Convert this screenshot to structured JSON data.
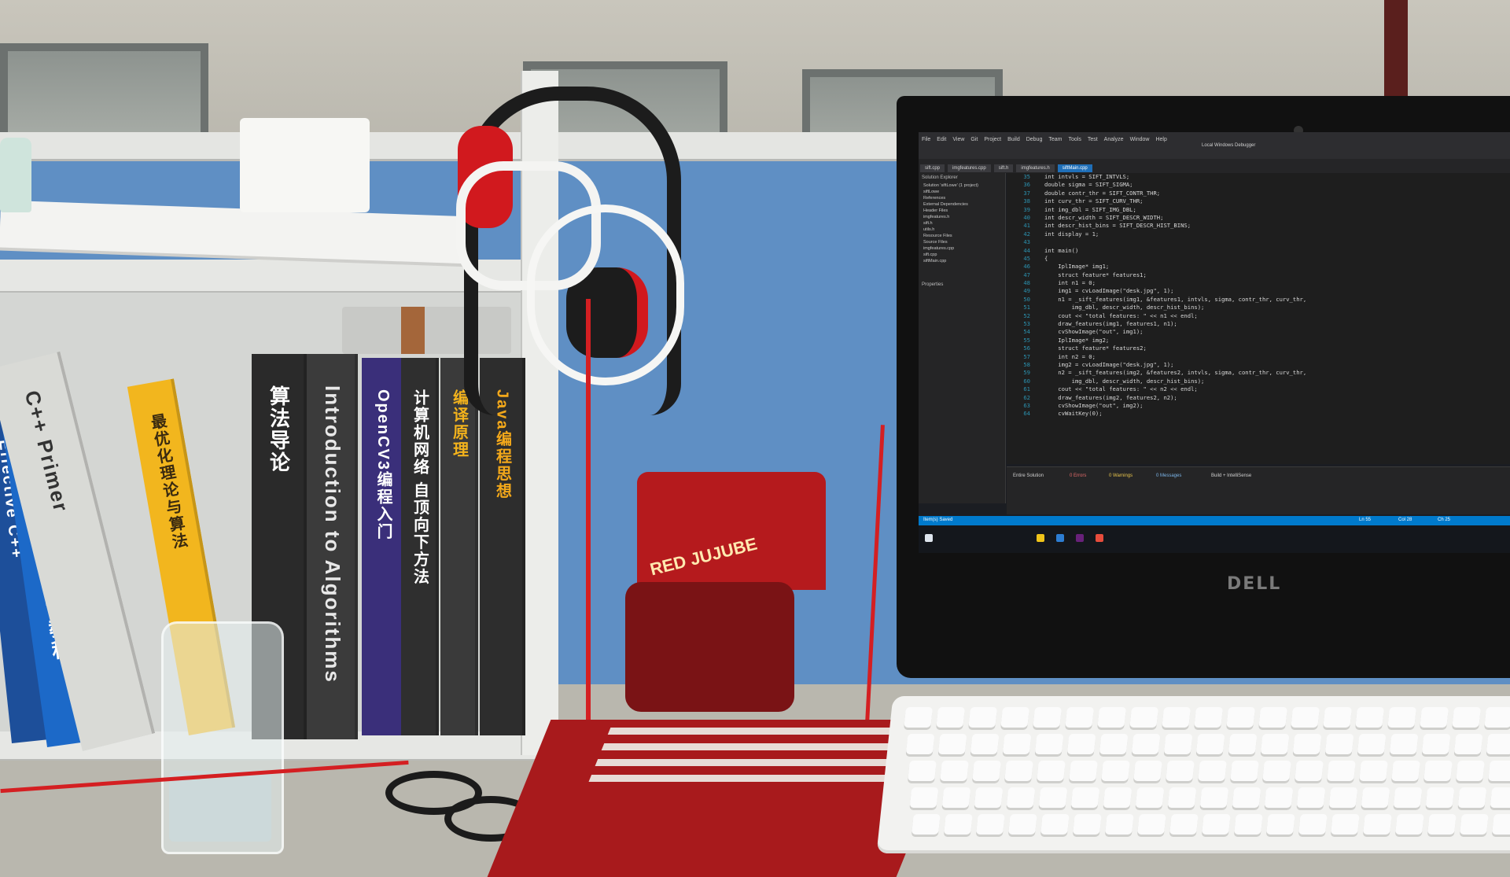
{
  "scene": {
    "description_tags": [
      "desk",
      "bookshelf",
      "monitor",
      "keyboard",
      "headphones",
      "jujube-bag",
      "glass-jar"
    ]
  },
  "books": [
    {
      "title": "Effective C++",
      "color": "#1d4f9a",
      "text_color": "#ffffff"
    },
    {
      "title": "Verilog 数字系统设计教程",
      "color": "#1c69c8",
      "text_color": "#ffffff"
    },
    {
      "title": "C++ Primer",
      "color": "#d9dad6",
      "text_color": "#333333"
    },
    {
      "title": "最优化理论与算法",
      "color": "#f2b61e",
      "text_color": "#3a2a10"
    },
    {
      "title": "算法导论",
      "color": "#2a2a2a",
      "text_color": "#ffffff"
    },
    {
      "title": "Introduction to Algorithms",
      "color": "#3b3b3b",
      "text_color": "#e8e8e8"
    },
    {
      "title": "OpenCV3编程入门",
      "color": "#3a2f7a",
      "text_color": "#ffffff"
    },
    {
      "title": "计算机网络 自顶向下方法",
      "color": "#2f2f2f",
      "text_color": "#ffffff"
    },
    {
      "title": "编译原理",
      "color": "#3a3a3a",
      "text_color": "#f2b21c"
    },
    {
      "title": "Java编程思想",
      "color": "#2d2d2d",
      "text_color": "#f3a81a"
    }
  ],
  "monitor": {
    "brand": "DELL",
    "ide": {
      "menu": [
        "File",
        "Edit",
        "View",
        "Git",
        "Project",
        "Build",
        "Debug",
        "Team",
        "Tools",
        "Test",
        "Analyze",
        "Window",
        "Help"
      ],
      "debugger_label": "Local Windows Debugger",
      "tabs": [
        "sift.cpp",
        "imgfeatures.cpp",
        "sift.h",
        "imgfeatures.h",
        "siftMain.cpp"
      ],
      "active_tab": "siftMain.cpp",
      "solution_title": "Solution Explorer",
      "solution_items": [
        "Solution 'siftLowe' (1 project)",
        "siftLowe",
        "References",
        "External Dependencies",
        "Header Files",
        "imgfeatures.h",
        "sift.h",
        "utils.h",
        "Resource Files",
        "Source Files",
        "imgfeatures.cpp",
        "sift.cpp",
        "siftMain.cpp"
      ],
      "properties_title": "Properties",
      "code_lines": [
        {
          "n": "35",
          "text": "int intvls = SIFT_INTVLS;"
        },
        {
          "n": "36",
          "text": "double sigma = SIFT_SIGMA;"
        },
        {
          "n": "37",
          "text": "double contr_thr = SIFT_CONTR_THR;"
        },
        {
          "n": "38",
          "text": "int curv_thr = SIFT_CURV_THR;"
        },
        {
          "n": "39",
          "text": "int img_dbl = SIFT_IMG_DBL;"
        },
        {
          "n": "40",
          "text": "int descr_width = SIFT_DESCR_WIDTH;"
        },
        {
          "n": "41",
          "text": "int descr_hist_bins = SIFT_DESCR_HIST_BINS;"
        },
        {
          "n": "42",
          "text": "int display = 1;"
        },
        {
          "n": "43",
          "text": ""
        },
        {
          "n": "44",
          "text": "int main()"
        },
        {
          "n": "45",
          "text": "{"
        },
        {
          "n": "46",
          "text": "    IplImage* img1;"
        },
        {
          "n": "47",
          "text": "    struct feature* features1;"
        },
        {
          "n": "48",
          "text": "    int n1 = 0;"
        },
        {
          "n": "49",
          "text": "    img1 = cvLoadImage(\"desk.jpg\", 1);"
        },
        {
          "n": "50",
          "text": "    n1 = _sift_features(img1, &features1, intvls, sigma, contr_thr, curv_thr,"
        },
        {
          "n": "51",
          "text": "        img_dbl, descr_width, descr_hist_bins);"
        },
        {
          "n": "52",
          "text": "    cout << \"total features: \" << n1 << endl;"
        },
        {
          "n": "53",
          "text": "    draw_features(img1, features1, n1);"
        },
        {
          "n": "54",
          "text": "    cvShowImage(\"out\", img1);"
        },
        {
          "n": "55",
          "text": "    IplImage* img2;"
        },
        {
          "n": "56",
          "text": "    struct feature* features2;"
        },
        {
          "n": "57",
          "text": "    int n2 = 0;"
        },
        {
          "n": "58",
          "text": "    img2 = cvLoadImage(\"desk.jpg\", 1);"
        },
        {
          "n": "59",
          "text": "    n2 = _sift_features(img2, &features2, intvls, sigma, contr_thr, curv_thr,"
        },
        {
          "n": "60",
          "text": "        img_dbl, descr_width, descr_hist_bins);"
        },
        {
          "n": "61",
          "text": "    cout << \"total features: \" << n2 << endl;"
        },
        {
          "n": "62",
          "text": "    draw_features(img2, features2, n2);"
        },
        {
          "n": "63",
          "text": "    cvShowImage(\"out\", img2);"
        },
        {
          "n": "64",
          "text": "    cvWaitKey(0);"
        }
      ],
      "output": {
        "scope": "Entire Solution",
        "errors": "0 Errors",
        "warnings": "0 Warnings",
        "messages": "0 Messages",
        "filter": "Build + IntelliSense"
      },
      "statusbar": {
        "left": "Item(s) Saved",
        "ln": "Ln 55",
        "col": "Col 28",
        "ch": "Ch 25"
      }
    }
  },
  "bag": {
    "brand": "RED JUJUBE"
  },
  "colors": {
    "partition": "#5f8fc4",
    "cable": "#d41f22",
    "mousepad": "#a81a1c"
  }
}
